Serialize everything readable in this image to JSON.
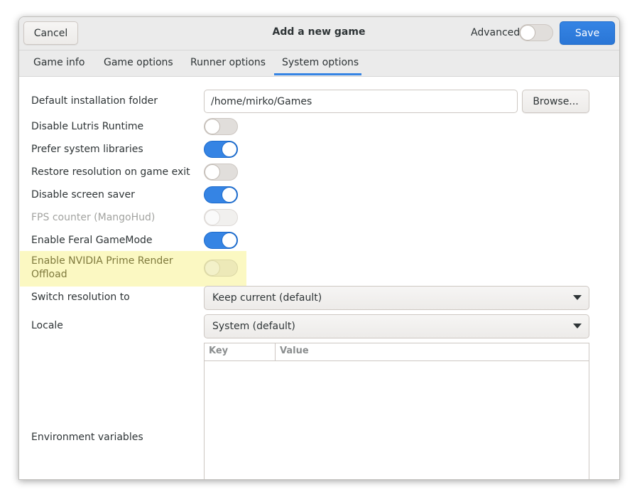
{
  "header": {
    "cancel_label": "Cancel",
    "title": "Add a new game",
    "advanced_label": "Advanced",
    "advanced_on": false,
    "save_label": "Save"
  },
  "tabs": [
    {
      "label": "Game info",
      "active": false
    },
    {
      "label": "Game options",
      "active": false
    },
    {
      "label": "Runner options",
      "active": false
    },
    {
      "label": "System options",
      "active": true
    }
  ],
  "options": {
    "install_folder": {
      "label": "Default installation folder",
      "value": "/home/mirko/Games",
      "browse_label": "Browse..."
    },
    "disable_runtime": {
      "label": "Disable Lutris Runtime",
      "on": false
    },
    "prefer_system_libs": {
      "label": "Prefer system libraries",
      "on": true
    },
    "restore_resolution": {
      "label": "Restore resolution on game exit",
      "on": false
    },
    "disable_screensaver": {
      "label": "Disable screen saver",
      "on": true
    },
    "fps_counter": {
      "label": "FPS counter (MangoHud)",
      "on": false,
      "disabled": true
    },
    "feral_gamemode": {
      "label": "Enable Feral GameMode",
      "on": true
    },
    "nvidia_prime": {
      "label": "Enable NVIDIA Prime Render Offload",
      "on": false,
      "disabled": true,
      "highlighted": true
    },
    "switch_resolution": {
      "label": "Switch resolution to",
      "value": "Keep current (default)"
    },
    "locale": {
      "label": "Locale",
      "value": "System (default)"
    },
    "env_vars": {
      "label": "Environment variables",
      "col_key": "Key",
      "col_value": "Value"
    }
  },
  "colors": {
    "accent": "#3584e4",
    "highlight": "#fbf8c2"
  }
}
